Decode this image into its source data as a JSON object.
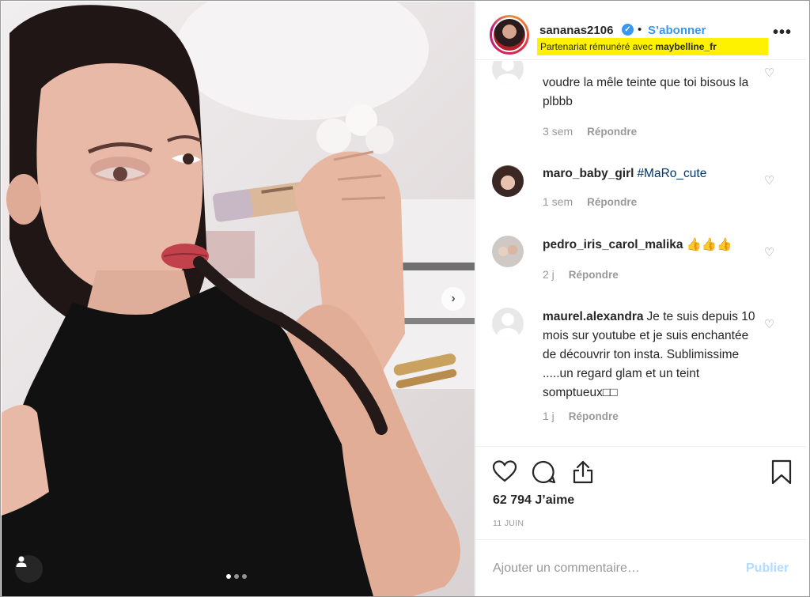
{
  "post": {
    "username": "sananas2106",
    "follow_label": "S’abonner",
    "separator": "•",
    "verified_glyph": "✓",
    "partnership_prefix": "Partenariat rémunéré avec ",
    "partnership_brand": "maybelline_fr",
    "more_glyph": "•••",
    "likes": "62 794 J’aime",
    "date": "11 JUIN",
    "carousel": {
      "slides": 3,
      "active": 1
    }
  },
  "comments": [
    {
      "user": "",
      "text": "voudre la mêle teinte que toi bisous la plbbb",
      "time": "3 sem",
      "reply": "Répondre",
      "avatar": "default"
    },
    {
      "user": "maro_baby_girl",
      "text": "",
      "tag": "#MaRo_cute",
      "time": "1 sem",
      "reply": "Répondre",
      "avatar": "girl"
    },
    {
      "user": "pedro_iris_carol_malika",
      "text": "👍👍👍",
      "time": "2 j",
      "reply": "Répondre",
      "avatar": "group"
    },
    {
      "user": "maurel.alexandra",
      "text": "Je te suis depuis 10 mois sur youtube et je suis enchantée de découvrir ton insta. Sublimissime .....un regard glam et un teint somptueux□□",
      "time": "1 j",
      "reply": "Répondre",
      "avatar": "default"
    }
  ],
  "add_comment": {
    "placeholder": "Ajouter un commentaire…",
    "publish_label": "Publier"
  },
  "icons": {
    "like": "heart-icon",
    "comment": "comment-bubble-icon",
    "share": "share-icon",
    "save": "bookmark-icon",
    "next": "chevron-right-icon",
    "user_tags": "person-icon"
  },
  "colors": {
    "accent": "#3897f0",
    "highlight": "#fff200",
    "publish_disabled": "#b3dbff",
    "muted": "#999999"
  }
}
